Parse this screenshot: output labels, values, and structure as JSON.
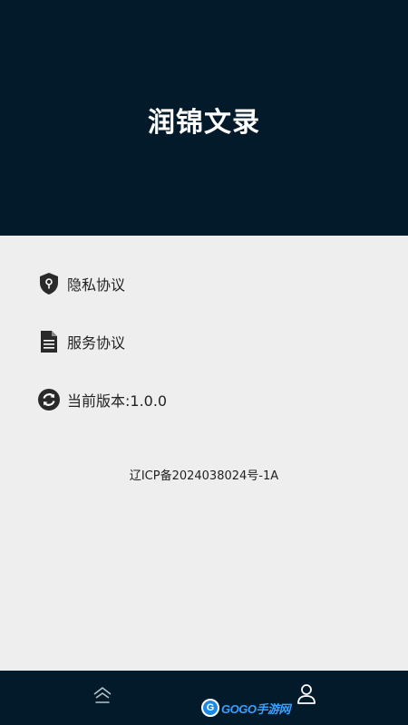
{
  "header": {
    "title": "润锦文录",
    "background": "#021a2a"
  },
  "menu": {
    "items": [
      {
        "label": "隐私协议",
        "icon": "shield-keyhole-icon"
      },
      {
        "label": "服务协议",
        "icon": "document-icon"
      },
      {
        "label": "当前版本:1.0.0",
        "icon": "refresh-icon"
      }
    ]
  },
  "footer": {
    "icp": "辽ICP备2024038024号-1A"
  },
  "bottom_nav": {
    "home_icon": "home-icon",
    "user_icon": "user-icon",
    "background": "#021a2a"
  },
  "watermark": {
    "badge": "G",
    "text": "GOGO手游网"
  }
}
